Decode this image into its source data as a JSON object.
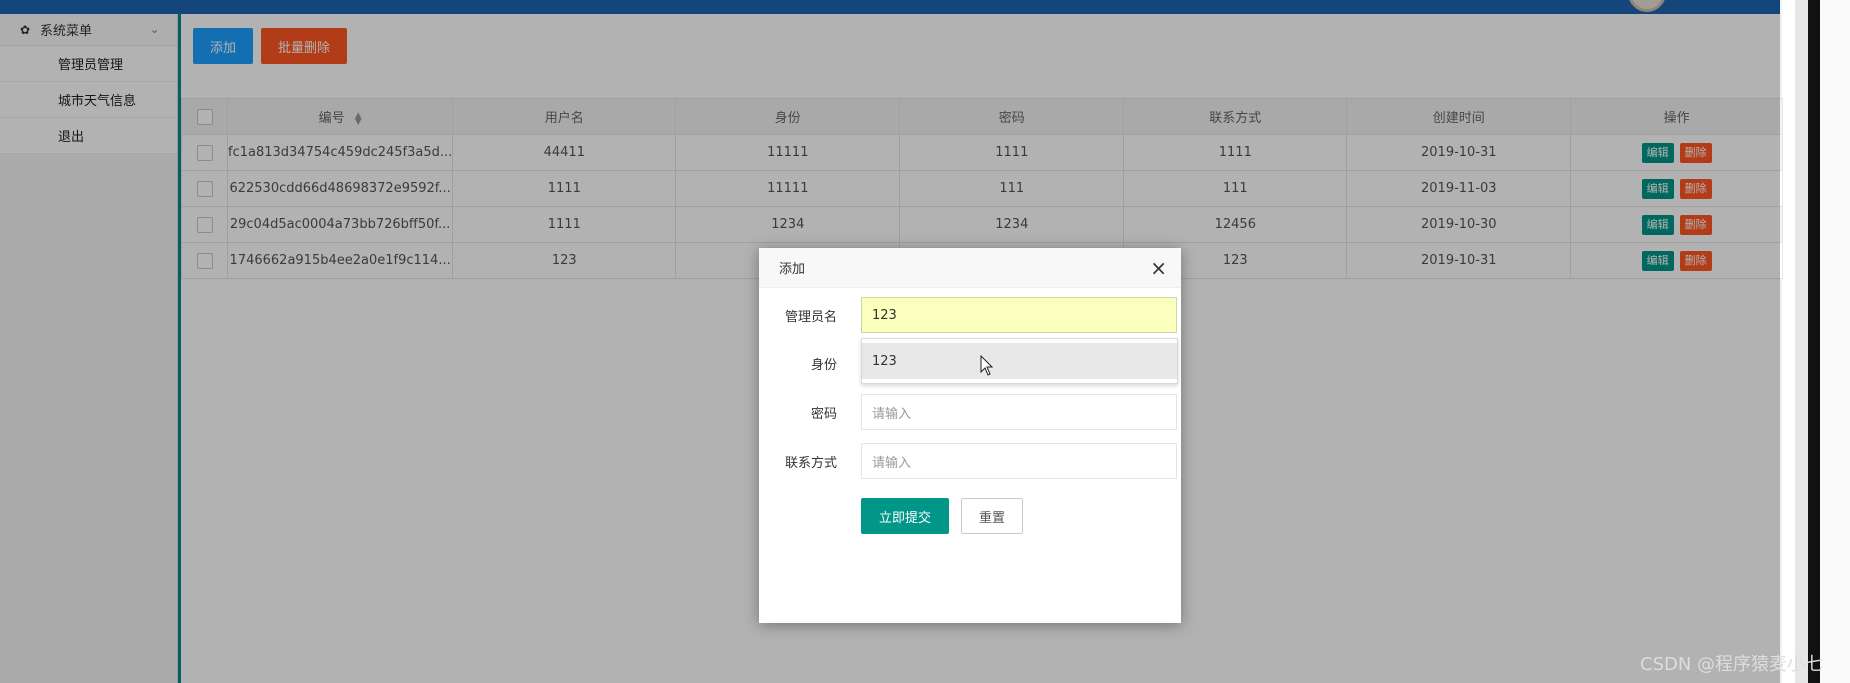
{
  "sidebar": {
    "menu_title": "系统菜单",
    "items": [
      {
        "label": "管理员管理"
      },
      {
        "label": "城市天气信息"
      },
      {
        "label": "退出"
      }
    ]
  },
  "toolbar": {
    "add_label": "添加",
    "batch_delete_label": "批量删除"
  },
  "table": {
    "columns": [
      "编号",
      "用户名",
      "身份",
      "密码",
      "联系方式",
      "创建时间",
      "操作"
    ],
    "rows": [
      {
        "id": "fc1a813d34754c459dc245f3a5d...",
        "username": "44411",
        "identity": "11111",
        "password": "1111",
        "contact": "1111",
        "created": "2019-10-31"
      },
      {
        "id": "622530cdd66d48698372e9592f...",
        "username": "1111",
        "identity": "11111",
        "password": "111",
        "contact": "111",
        "created": "2019-11-03"
      },
      {
        "id": "29c04d5ac0004a73bb726bff50f...",
        "username": "1111",
        "identity": "1234",
        "password": "1234",
        "contact": "12456",
        "created": "2019-10-30"
      },
      {
        "id": "1746662a915b4ee2a0e1f9c114...",
        "username": "123",
        "identity": "",
        "password": "",
        "contact": "123",
        "created": "2019-10-31"
      }
    ],
    "edit_label": "编辑",
    "delete_label": "删除"
  },
  "modal": {
    "title": "添加",
    "close_glyph": "×",
    "fields": {
      "name_label": "管理员名",
      "name_value": "123",
      "identity_label": "身份",
      "password_label": "密码",
      "password_placeholder": "请输入",
      "contact_label": "联系方式",
      "contact_placeholder": "请输入"
    },
    "suggestion": "123",
    "submit_label": "立即提交",
    "reset_label": "重置"
  },
  "watermark": "CSDN @程序猿麦小七",
  "colors": {
    "topbar": "#1E63B0",
    "accent_teal": "#009688",
    "add_blue": "#1E9FFF",
    "delete_orange": "#FF5722",
    "autofill_yellow": "#faffbd"
  },
  "icons": [
    "gear-icon",
    "chevron-down-icon",
    "sort-icon",
    "close-icon",
    "cursor-icon"
  ]
}
